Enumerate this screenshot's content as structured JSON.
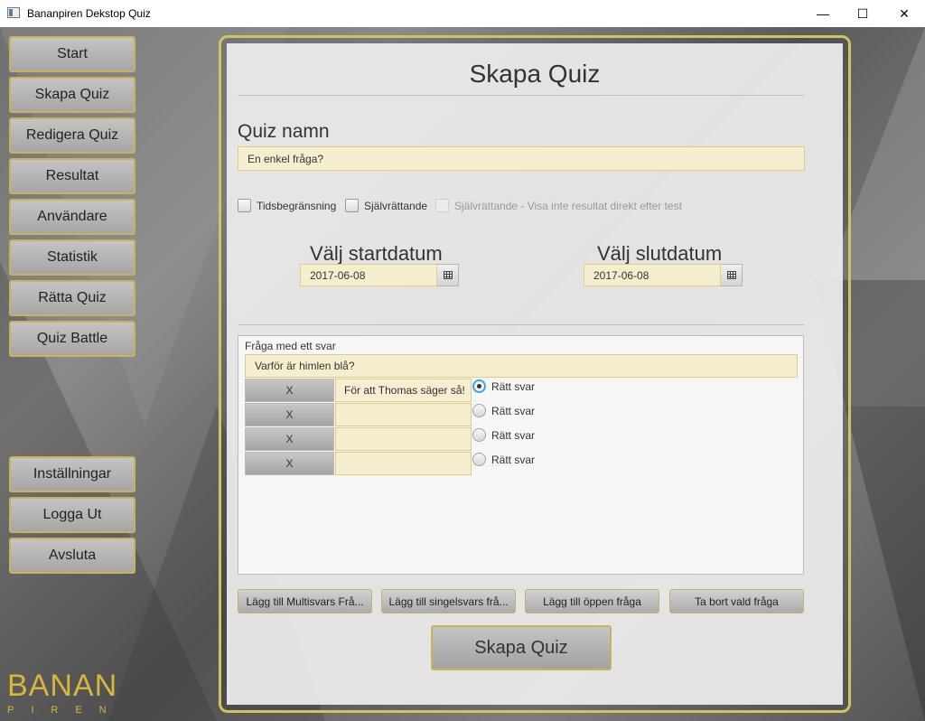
{
  "window": {
    "title": "Bananpiren Dekstop Quiz",
    "minimize": "—",
    "maximize": "☐",
    "close": "✕"
  },
  "nav": {
    "items": [
      "Start",
      "Skapa Quiz",
      "Redigera Quiz",
      "Resultat",
      "Användare",
      "Statistik",
      "Rätta Quiz",
      "Quiz Battle"
    ],
    "bottom_items": [
      "Inställningar",
      "Logga Ut",
      "Avsluta"
    ]
  },
  "logo": {
    "main": "BANAN",
    "sub": "PIREN"
  },
  "form": {
    "heading": "Skapa Quiz",
    "quiz_name_label": "Quiz namn",
    "quiz_name_value": "En enkel fråga?",
    "checkboxes": [
      {
        "label": "Tidsbegränsning",
        "checked": false,
        "enabled": true
      },
      {
        "label": "Självrättande",
        "checked": false,
        "enabled": true
      },
      {
        "label": "Självrättande - Visa inte resultat direkt efter test",
        "checked": false,
        "enabled": false
      }
    ],
    "start_label": "Välj startdatum",
    "start_date": "2017-06-08",
    "end_label": "Välj slutdatum",
    "end_date": "2017-06-08"
  },
  "question": {
    "type_label": "Fråga med ett svar",
    "text": "Varför är himlen blå?",
    "answers": [
      {
        "remove": "X",
        "text": "För att Thomas säger så!",
        "radio_label": "Rätt svar",
        "selected": true
      },
      {
        "remove": "X",
        "text": "",
        "radio_label": "Rätt svar",
        "selected": false
      },
      {
        "remove": "X",
        "text": "",
        "radio_label": "Rätt svar",
        "selected": false
      },
      {
        "remove": "X",
        "text": "",
        "radio_label": "Rätt svar",
        "selected": false
      }
    ]
  },
  "actions": {
    "add_multi": "Lägg till Multisvars Frå...",
    "add_single": "Lägg till singelsvars frå...",
    "add_open": "Lägg till öppen fråga",
    "remove_selected": "Ta bort vald fråga",
    "create": "Skapa Quiz"
  },
  "colors": {
    "accent": "#c9b25a",
    "field_bg": "#f6efcf",
    "radio_focus": "#3da5d9"
  }
}
